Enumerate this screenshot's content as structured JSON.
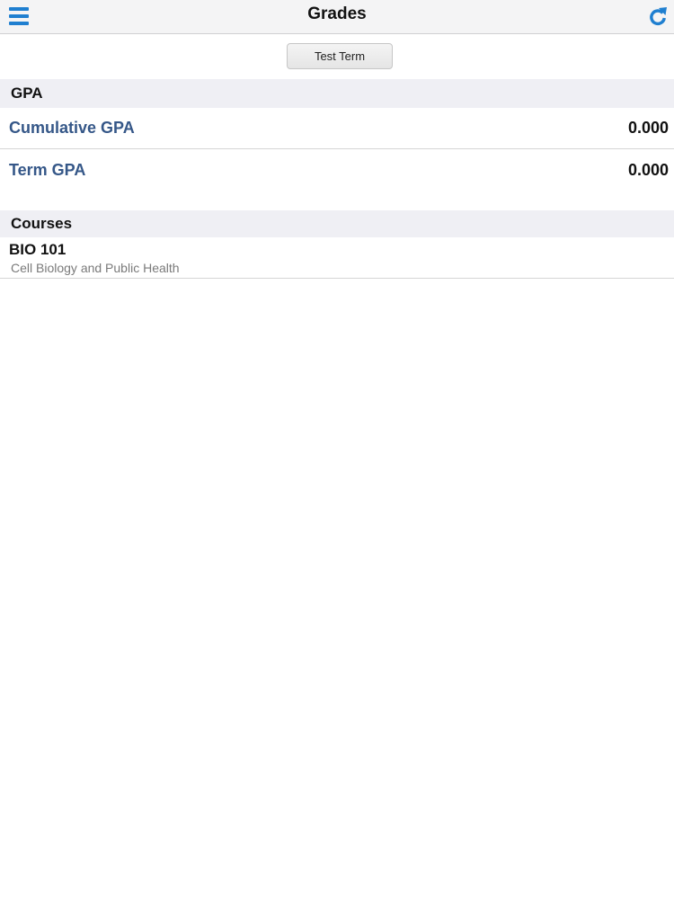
{
  "navbar": {
    "title": "Grades",
    "menu_icon": "hamburger-menu-icon",
    "refresh_icon": "refresh-icon",
    "accent_color": "#1f7fd0"
  },
  "term_selector": {
    "label": "Test Term"
  },
  "gpa_section": {
    "header": "GPA",
    "rows": [
      {
        "label": "Cumulative GPA",
        "value": "0.000"
      },
      {
        "label": "Term GPA",
        "value": "0.000"
      }
    ]
  },
  "courses_section": {
    "header": "Courses",
    "items": [
      {
        "code": "BIO 101",
        "name": "Cell Biology and Public Health"
      }
    ]
  }
}
